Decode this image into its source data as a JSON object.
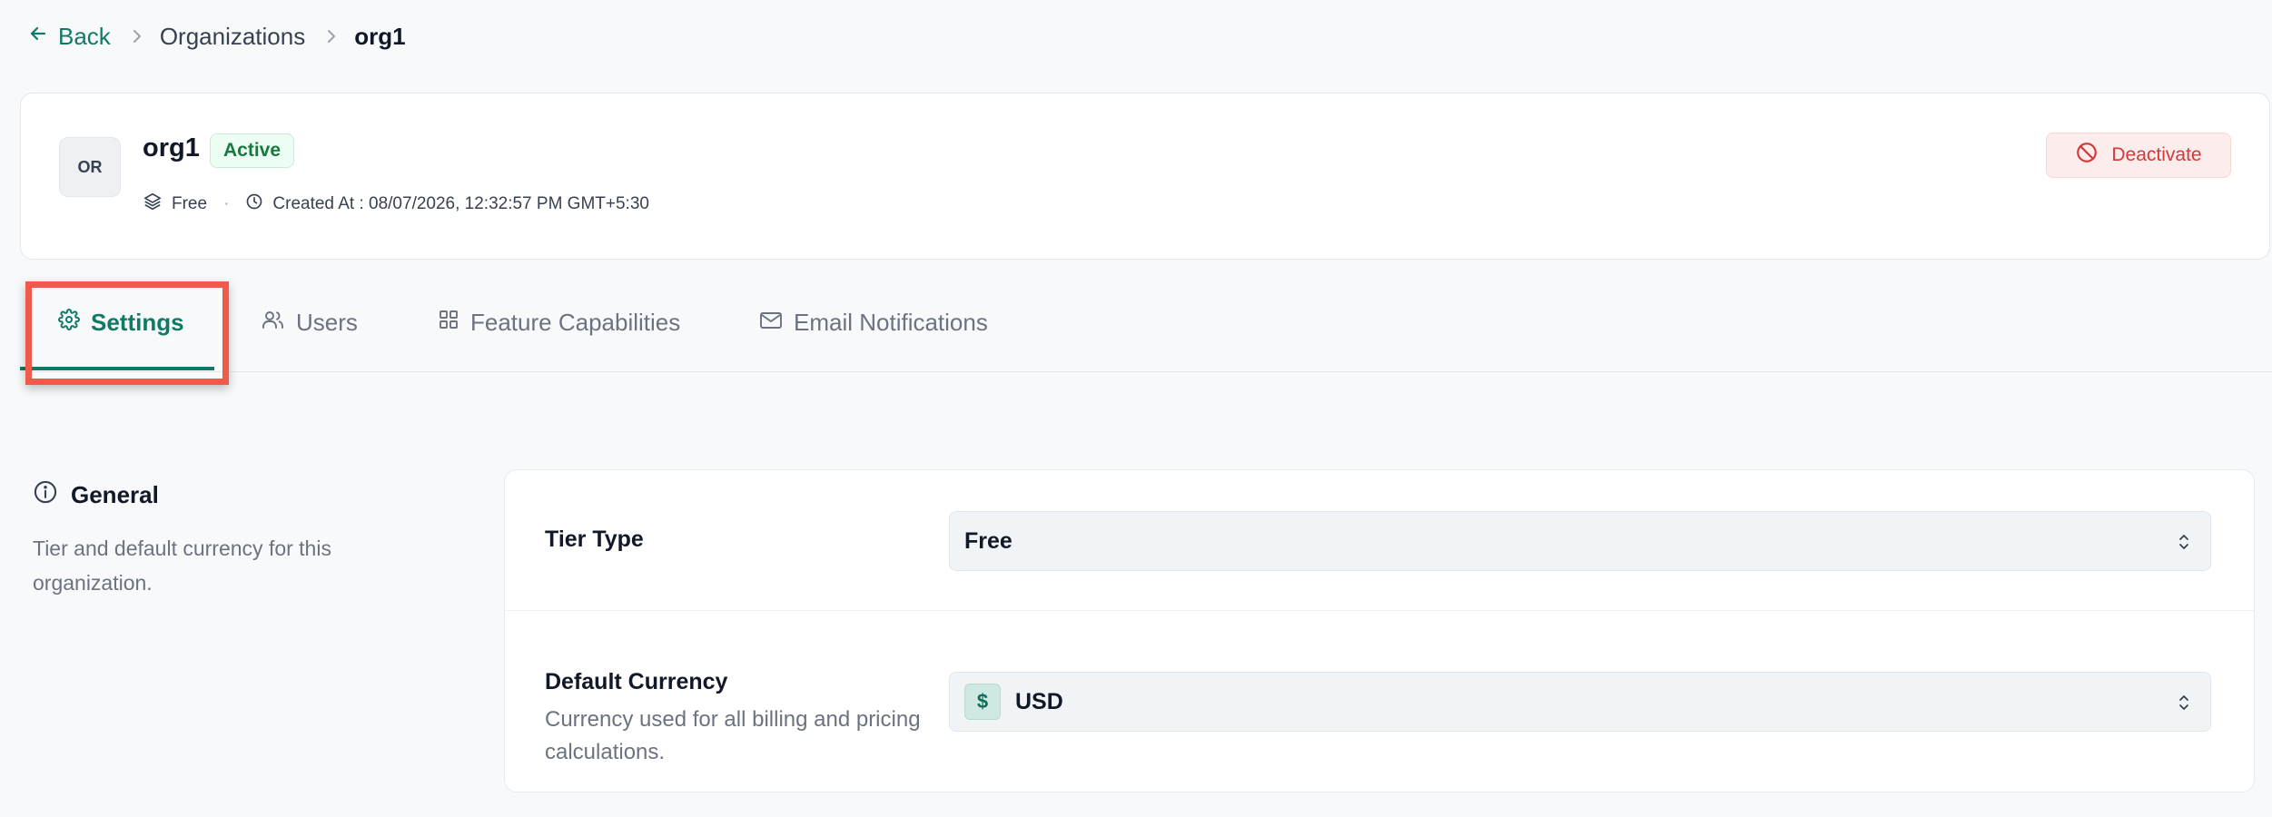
{
  "breadcrumb": {
    "back_label": "Back",
    "parent_label": "Organizations",
    "current_label": "org1"
  },
  "org": {
    "avatar_initials": "OR",
    "name": "org1",
    "status": "Active",
    "tier": "Free",
    "created_at": "Created At : 08/07/2026, 12:32:57 PM GMT+5:30",
    "deactivate_label": "Deactivate"
  },
  "tabs": [
    {
      "label": "Settings",
      "icon": "gear-icon",
      "active": true
    },
    {
      "label": "Users",
      "icon": "users-icon",
      "active": false
    },
    {
      "label": "Feature Capabilities",
      "icon": "grid-icon",
      "active": false
    },
    {
      "label": "Email Notifications",
      "icon": "mail-icon",
      "active": false
    }
  ],
  "general": {
    "title": "General",
    "description": "Tier and default currency for this organization.",
    "icon": "info-icon"
  },
  "settings": {
    "tier_type": {
      "label": "Tier Type",
      "value": "Free"
    },
    "default_currency": {
      "label": "Default Currency",
      "description": "Currency used for all billing and pricing calculations.",
      "symbol": "$",
      "value": "USD"
    }
  },
  "colors": {
    "accent": "#0f7a66",
    "danger": "#d33a3a",
    "highlight": "#ef5a4b"
  }
}
